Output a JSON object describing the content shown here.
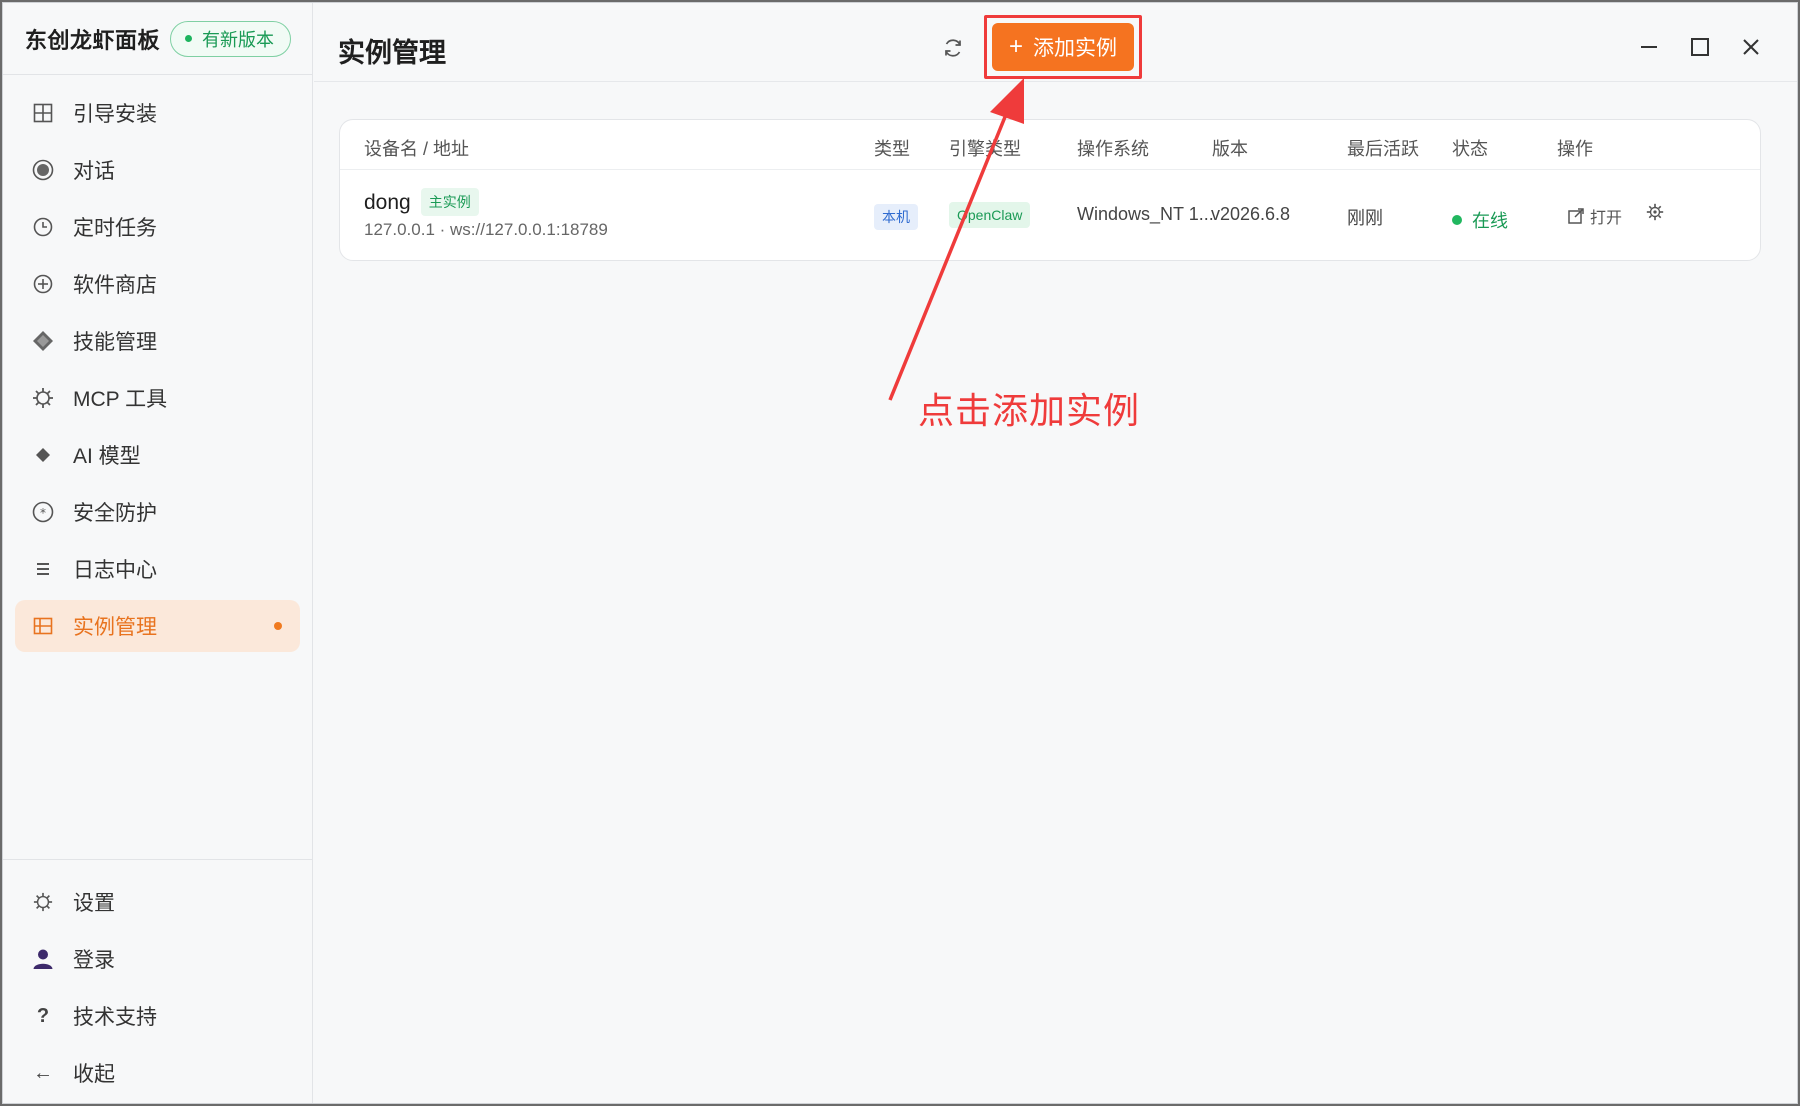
{
  "app": {
    "brand_title": "东创龙虾面板",
    "update_badge": "有新版本"
  },
  "sidebar": {
    "items": [
      {
        "label": "引导安装",
        "icon": "grid-icon"
      },
      {
        "label": "对话",
        "icon": "chat-bubble-icon"
      },
      {
        "label": "定时任务",
        "icon": "clock-icon"
      },
      {
        "label": "软件商店",
        "icon": "store-icon"
      },
      {
        "label": "技能管理",
        "icon": "diamond-icon"
      },
      {
        "label": "MCP 工具",
        "icon": "gear-tool-icon"
      },
      {
        "label": "AI 模型",
        "icon": "sparkle-icon"
      },
      {
        "label": "安全防护",
        "icon": "shield-icon"
      },
      {
        "label": "日志中心",
        "icon": "list-icon"
      },
      {
        "label": "实例管理",
        "icon": "instance-icon",
        "active": true
      }
    ],
    "bottom_items": [
      {
        "label": "设置",
        "icon": "settings-icon"
      },
      {
        "label": "登录",
        "icon": "user-icon"
      },
      {
        "label": "技术支持",
        "icon": "help-icon"
      },
      {
        "label": "收起",
        "icon": "arrow-left-icon"
      }
    ]
  },
  "header": {
    "title": "实例管理",
    "add_button_label": "添加实例",
    "add_button_icon": "+"
  },
  "table": {
    "columns": [
      "设备名 / 地址",
      "类型",
      "引擎类型",
      "操作系统",
      "版本",
      "最后活跃",
      "状态",
      "操作"
    ],
    "rows": [
      {
        "device_name": "dong",
        "main_tag": "主实例",
        "address": "127.0.0.1 · ws://127.0.0.1:18789",
        "type": "本机",
        "engine": "OpenClaw",
        "os": "Windows_NT 1...",
        "version": "v2026.6.8",
        "last_active": "刚刚",
        "status": "在线",
        "open_label": "打开"
      }
    ]
  },
  "annotation": {
    "text": "点击添加实例",
    "color": "#ef3b3b"
  },
  "colors": {
    "accent": "#f57320",
    "active_bg": "#fbe8da",
    "online": "#21b75f"
  }
}
